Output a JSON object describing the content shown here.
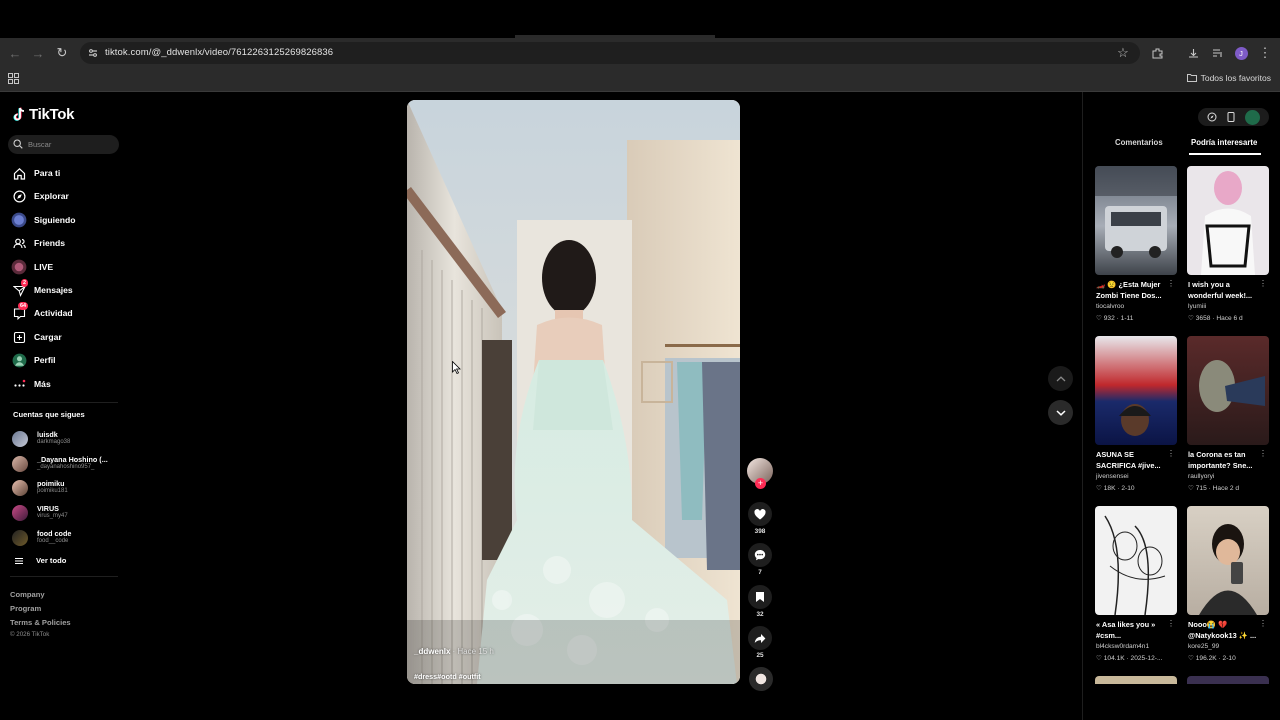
{
  "browser": {
    "url": "tiktok.com/@_ddwenlx/video/7612263125269826836",
    "bookmarks_folder": "Todos los favoritos",
    "profile_initial": "J"
  },
  "sidebar": {
    "logo": "TikTok",
    "search_placeholder": "Buscar",
    "nav": [
      {
        "label": "Para ti",
        "icon": "home-icon"
      },
      {
        "label": "Explorar",
        "icon": "compass-icon"
      },
      {
        "label": "Siguiendo",
        "icon": "following-icon"
      },
      {
        "label": "Friends",
        "icon": "friends-icon"
      },
      {
        "label": "LIVE",
        "icon": "live-icon"
      },
      {
        "label": "Mensajes",
        "icon": "messages-icon",
        "badge": "2"
      },
      {
        "label": "Actividad",
        "icon": "activity-icon",
        "badge": "64"
      },
      {
        "label": "Cargar",
        "icon": "upload-icon"
      },
      {
        "label": "Perfil",
        "icon": "profile-icon"
      },
      {
        "label": "Más",
        "icon": "more-icon"
      }
    ],
    "following_title": "Cuentas que sigues",
    "following": [
      {
        "name": "luisdk",
        "handle": "darkmago38"
      },
      {
        "name": "_Dayana Hoshino (...",
        "handle": "_dayanahoshino957_"
      },
      {
        "name": "poimiku",
        "handle": "poimiku181"
      },
      {
        "name": "VIRUS",
        "handle": "virus_my47"
      },
      {
        "name": "food code",
        "handle": "food__code"
      }
    ],
    "see_all": "Ver todo",
    "footer": [
      "Company",
      "Program",
      "Terms & Policies"
    ],
    "copyright": "© 2026 TikTok"
  },
  "video": {
    "author": "_ddwenlx",
    "time": "· Hace 15 h",
    "tags": "#dress#ootd #outfit",
    "likes": "398",
    "comments": "7",
    "saves": "32",
    "shares": "25"
  },
  "right_panel": {
    "tabs": [
      "Comentarios",
      "Podría interesarte"
    ],
    "cards": [
      {
        "title": "🏎️ 😟 ¿Esta Mujer Zombi Tiene Dos...",
        "user": "tiocalvroo",
        "likes": "932",
        "date": "1-11"
      },
      {
        "title": "I wish you a wonderful week!...",
        "user": "lyumiii",
        "likes": "3658",
        "date": "Hace 6 d"
      },
      {
        "title": "ASUNA SE SACRIFICA #jive...",
        "user": "jivensensei",
        "likes": "18K",
        "date": "2-10"
      },
      {
        "title": "la Corona es tan importante? Sne...",
        "user": "raullyoryi",
        "likes": "715",
        "date": "Hace 2 d"
      },
      {
        "title": "« Asa likes you » #csm...",
        "user": "bl4cksw0rdam4n1",
        "likes": "104.1K",
        "date": "2025-12-..."
      },
      {
        "title": "Nooo😭 💔 @Natykook13 ✨ ...",
        "user": "kore25_99",
        "likes": "196.2K",
        "date": "2-10"
      }
    ]
  }
}
